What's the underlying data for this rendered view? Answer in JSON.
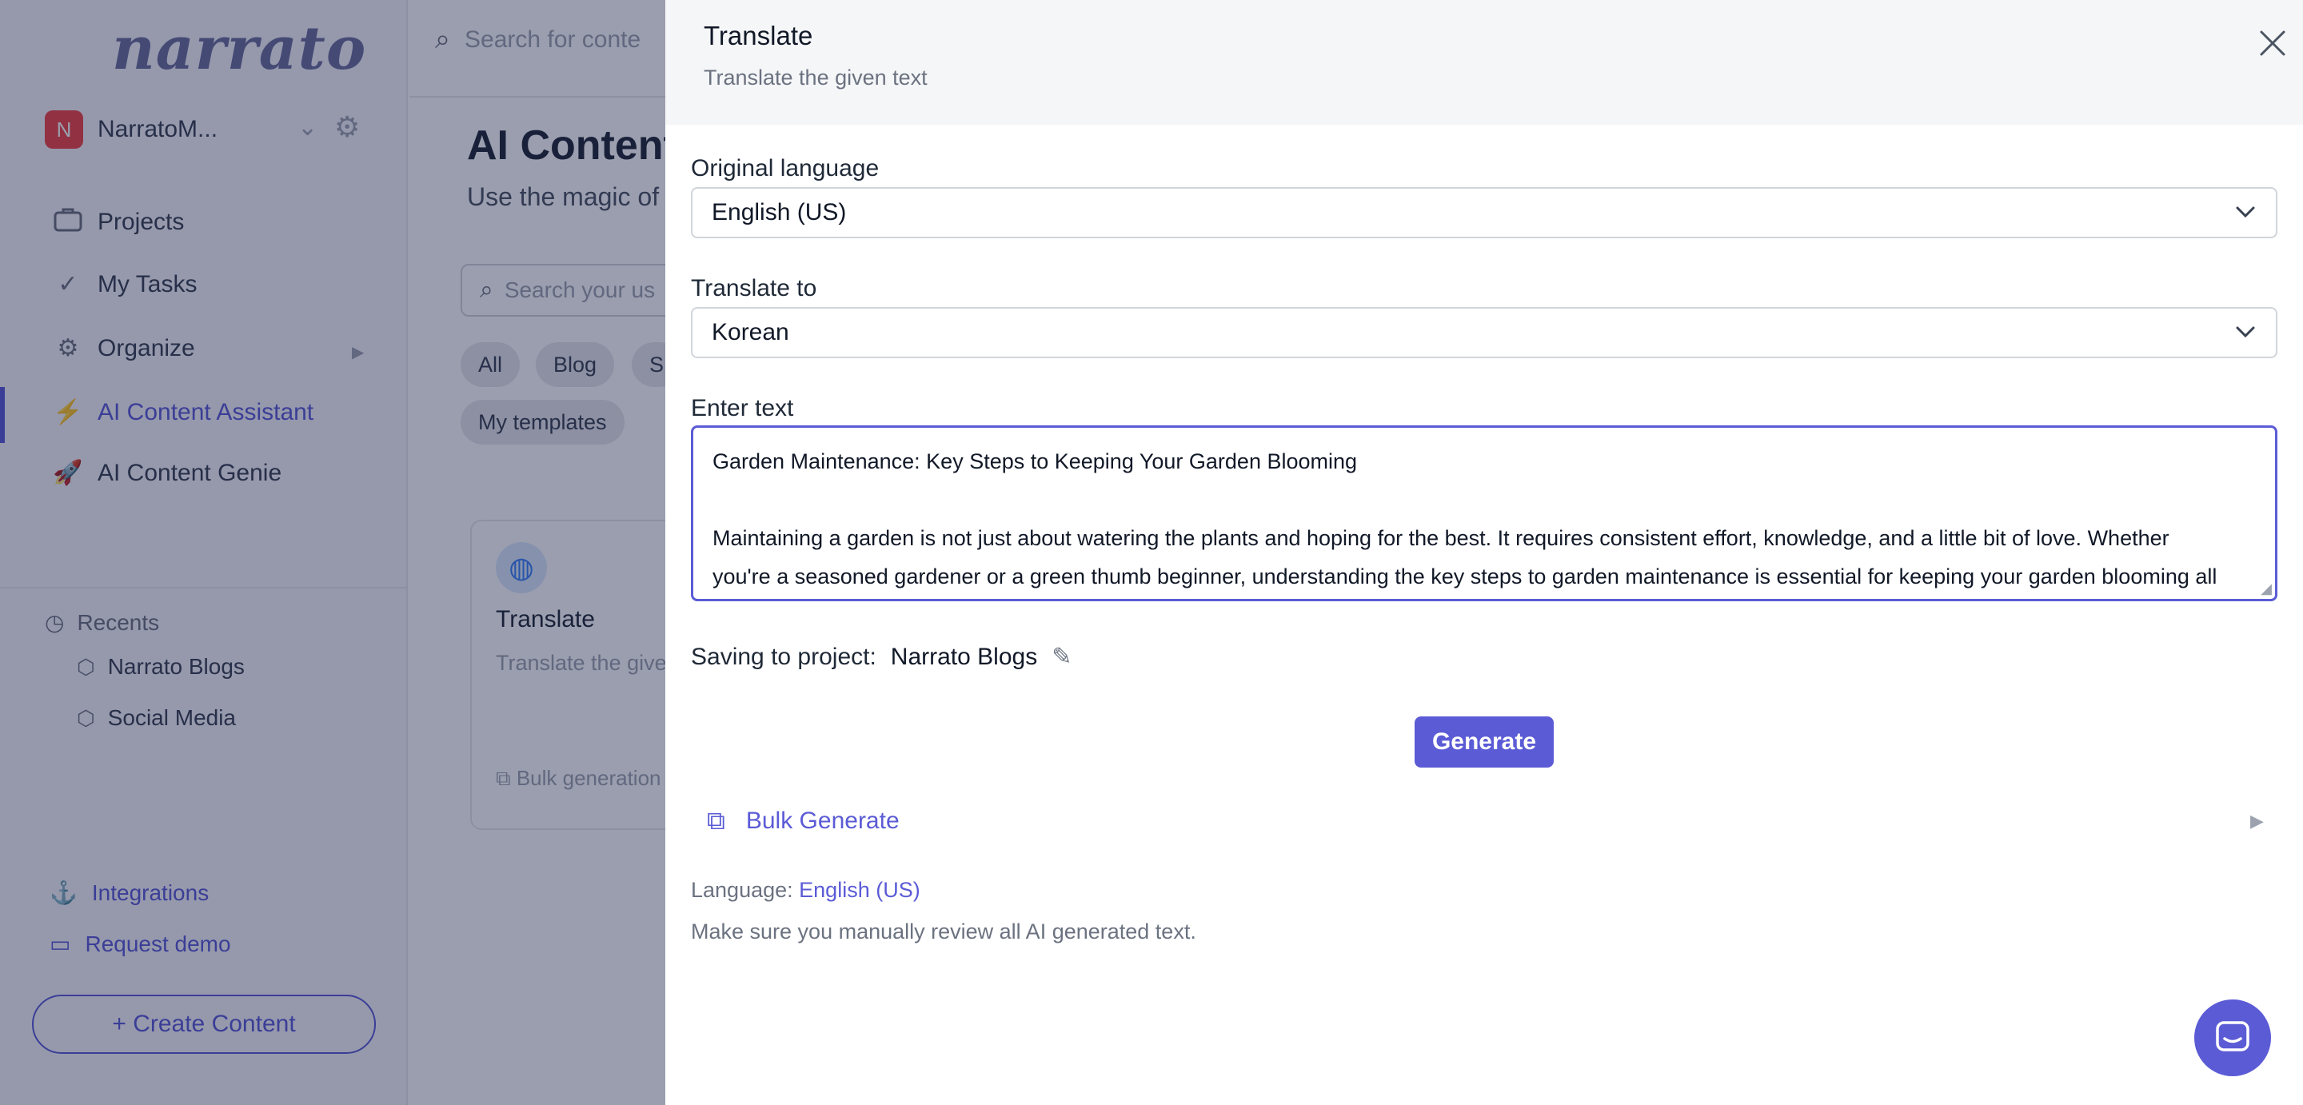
{
  "app": {
    "logo": "narrato",
    "workspace": {
      "avatar": "N",
      "name": "NarratoM..."
    },
    "nav": [
      {
        "label": "Projects",
        "icon": "briefcase-icon"
      },
      {
        "label": "My Tasks",
        "icon": "check-icon"
      },
      {
        "label": "Organize",
        "icon": "gears-icon"
      },
      {
        "label": "AI Content Assistant",
        "icon": "lightning-icon"
      },
      {
        "label": "AI Content Genie",
        "icon": "rocket-icon"
      }
    ],
    "recents": {
      "label": "Recents",
      "items": [
        "Narrato Blogs",
        "Social Media"
      ]
    },
    "bottom_links": [
      "Integrations",
      "Request demo"
    ],
    "create_button": "+ Create Content",
    "top_search_placeholder": "Search for conte",
    "page_title": "AI Content",
    "page_subtitle": "Use the magic of",
    "main_search_placeholder": "Search your us",
    "chips": [
      "All",
      "Blog",
      "S",
      "My templates"
    ],
    "card": {
      "title": "Translate",
      "description": "Translate the give",
      "footer": "Bulk generation"
    }
  },
  "modal": {
    "title": "Translate",
    "subtitle": "Translate the given text",
    "original_language_label": "Original language",
    "original_language_value": "English (US)",
    "translate_to_label": "Translate to",
    "translate_to_value": "Korean",
    "enter_text_label": "Enter text",
    "text_lines": [
      "Garden Maintenance: Key Steps to Keeping Your Garden Blooming",
      "",
      "Maintaining a garden is not just about watering the plants and hoping for the best. It requires consistent effort, knowledge, and a little bit of love. Whether",
      "you're a seasoned gardener or a green thumb beginner, understanding the key steps to garden maintenance is essential for keeping your garden blooming all"
    ],
    "saving_label": "Saving to project:",
    "saving_project": "Narrato Blogs",
    "generate_button": "Generate",
    "bulk_generate": "Bulk Generate",
    "language_label": "Language:",
    "language_value": "English (US)",
    "review_note": "Make sure you manually review all AI generated text."
  },
  "colors": {
    "accent": "#5b5bd6",
    "overlay": "#11183e",
    "header_bg": "#f5f6f8"
  }
}
